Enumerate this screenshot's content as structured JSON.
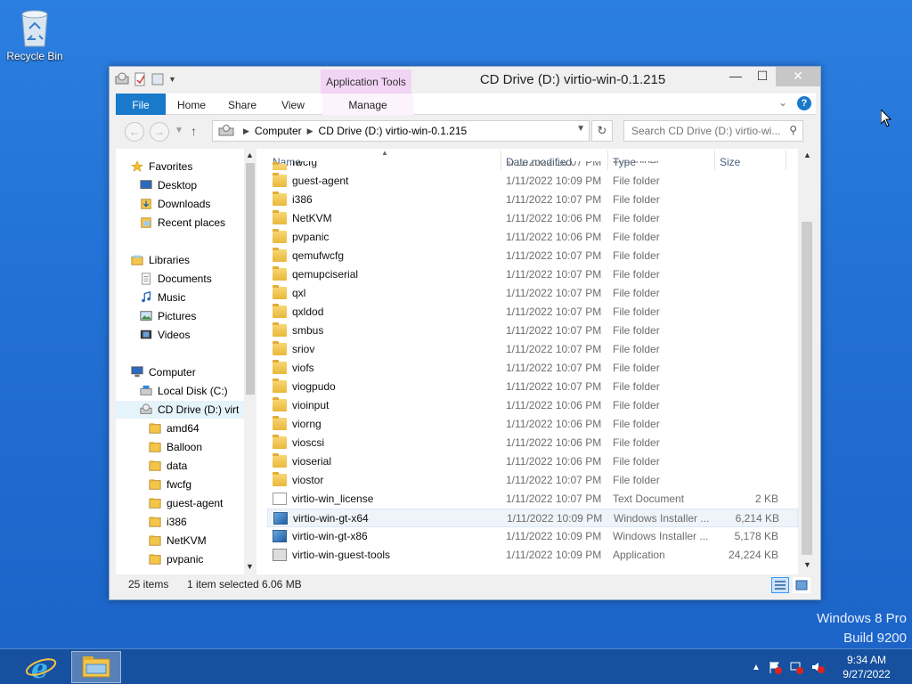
{
  "desktop": {
    "recycle_bin_label": "Recycle Bin",
    "watermark_line1": "Windows 8 Pro",
    "watermark_line2": "Build 9200"
  },
  "window": {
    "title": "CD Drive (D:) virtio-win-0.1.215",
    "contextual_tab_group": "Application Tools",
    "minimize_glyph": "—",
    "maximize_glyph": "☐",
    "close_glyph": "✕"
  },
  "ribbon": {
    "tabs": [
      "File",
      "Home",
      "Share",
      "View",
      "Manage"
    ],
    "help_glyph": "?"
  },
  "nav": {
    "breadcrumb": [
      "Computer",
      "CD Drive (D:) virtio-win-0.1.215"
    ],
    "search_placeholder": "Search CD Drive (D:) virtio-wi...",
    "back_glyph": "←",
    "forward_glyph": "→",
    "up_glyph": "↑",
    "refresh_glyph": "↻"
  },
  "navpane": {
    "items": [
      {
        "label": "Favorites",
        "icon": "star-icon",
        "indent": 0
      },
      {
        "label": "Desktop",
        "icon": "desktop-icon",
        "indent": 1
      },
      {
        "label": "Downloads",
        "icon": "downloads-icon",
        "indent": 1
      },
      {
        "label": "Recent places",
        "icon": "recent-places-icon",
        "indent": 1
      },
      {
        "label": "Libraries",
        "icon": "libraries-icon",
        "indent": 0
      },
      {
        "label": "Documents",
        "icon": "documents-icon",
        "indent": 1
      },
      {
        "label": "Music",
        "icon": "music-icon",
        "indent": 1
      },
      {
        "label": "Pictures",
        "icon": "pictures-icon",
        "indent": 1
      },
      {
        "label": "Videos",
        "icon": "videos-icon",
        "indent": 1
      },
      {
        "label": "Computer",
        "icon": "computer-icon",
        "indent": 0
      },
      {
        "label": "Local Disk (C:)",
        "icon": "local-disk-icon",
        "indent": 1
      },
      {
        "label": "CD Drive (D:) virt",
        "icon": "cd-drive-icon",
        "indent": 1,
        "selected": true
      },
      {
        "label": "amd64",
        "icon": "folder-icon",
        "indent": 2
      },
      {
        "label": "Balloon",
        "icon": "folder-icon",
        "indent": 2
      },
      {
        "label": "data",
        "icon": "folder-icon",
        "indent": 2
      },
      {
        "label": "fwcfg",
        "icon": "folder-icon",
        "indent": 2
      },
      {
        "label": "guest-agent",
        "icon": "folder-icon",
        "indent": 2
      },
      {
        "label": "i386",
        "icon": "folder-icon",
        "indent": 2
      },
      {
        "label": "NetKVM",
        "icon": "folder-icon",
        "indent": 2
      },
      {
        "label": "pvpanic",
        "icon": "folder-icon",
        "indent": 2
      }
    ]
  },
  "files": {
    "columns": [
      "Name",
      "Date modified",
      "Type",
      "Size"
    ],
    "rows": [
      {
        "name": "fwcfg",
        "date": "1/11/2022 10:07 PM",
        "type": "File folder",
        "size": "",
        "kind": "folder"
      },
      {
        "name": "guest-agent",
        "date": "1/11/2022 10:09 PM",
        "type": "File folder",
        "size": "",
        "kind": "folder"
      },
      {
        "name": "i386",
        "date": "1/11/2022 10:07 PM",
        "type": "File folder",
        "size": "",
        "kind": "folder"
      },
      {
        "name": "NetKVM",
        "date": "1/11/2022 10:06 PM",
        "type": "File folder",
        "size": "",
        "kind": "folder"
      },
      {
        "name": "pvpanic",
        "date": "1/11/2022 10:06 PM",
        "type": "File folder",
        "size": "",
        "kind": "folder"
      },
      {
        "name": "qemufwcfg",
        "date": "1/11/2022 10:07 PM",
        "type": "File folder",
        "size": "",
        "kind": "folder"
      },
      {
        "name": "qemupciserial",
        "date": "1/11/2022 10:07 PM",
        "type": "File folder",
        "size": "",
        "kind": "folder"
      },
      {
        "name": "qxl",
        "date": "1/11/2022 10:07 PM",
        "type": "File folder",
        "size": "",
        "kind": "folder"
      },
      {
        "name": "qxldod",
        "date": "1/11/2022 10:07 PM",
        "type": "File folder",
        "size": "",
        "kind": "folder"
      },
      {
        "name": "smbus",
        "date": "1/11/2022 10:07 PM",
        "type": "File folder",
        "size": "",
        "kind": "folder"
      },
      {
        "name": "sriov",
        "date": "1/11/2022 10:07 PM",
        "type": "File folder",
        "size": "",
        "kind": "folder"
      },
      {
        "name": "viofs",
        "date": "1/11/2022 10:07 PM",
        "type": "File folder",
        "size": "",
        "kind": "folder"
      },
      {
        "name": "viogpudo",
        "date": "1/11/2022 10:07 PM",
        "type": "File folder",
        "size": "",
        "kind": "folder"
      },
      {
        "name": "vioinput",
        "date": "1/11/2022 10:06 PM",
        "type": "File folder",
        "size": "",
        "kind": "folder"
      },
      {
        "name": "viorng",
        "date": "1/11/2022 10:06 PM",
        "type": "File folder",
        "size": "",
        "kind": "folder"
      },
      {
        "name": "vioscsi",
        "date": "1/11/2022 10:06 PM",
        "type": "File folder",
        "size": "",
        "kind": "folder"
      },
      {
        "name": "vioserial",
        "date": "1/11/2022 10:06 PM",
        "type": "File folder",
        "size": "",
        "kind": "folder"
      },
      {
        "name": "viostor",
        "date": "1/11/2022 10:07 PM",
        "type": "File folder",
        "size": "",
        "kind": "folder"
      },
      {
        "name": "virtio-win_license",
        "date": "1/11/2022 10:07 PM",
        "type": "Text Document",
        "size": "2 KB",
        "kind": "doc"
      },
      {
        "name": "virtio-win-gt-x64",
        "date": "1/11/2022 10:09 PM",
        "type": "Windows Installer ...",
        "size": "6,214 KB",
        "kind": "msi",
        "hover": true
      },
      {
        "name": "virtio-win-gt-x86",
        "date": "1/11/2022 10:09 PM",
        "type": "Windows Installer ...",
        "size": "5,178 KB",
        "kind": "msi"
      },
      {
        "name": "virtio-win-guest-tools",
        "date": "1/11/2022 10:09 PM",
        "type": "Application",
        "size": "24,224 KB",
        "kind": "app"
      }
    ]
  },
  "status": {
    "item_count": "25 items",
    "selection": "1 item selected",
    "selection_size": "6.06 MB"
  },
  "taskbar": {
    "clock_time": "9:34 AM",
    "clock_date": "9/27/2022"
  }
}
